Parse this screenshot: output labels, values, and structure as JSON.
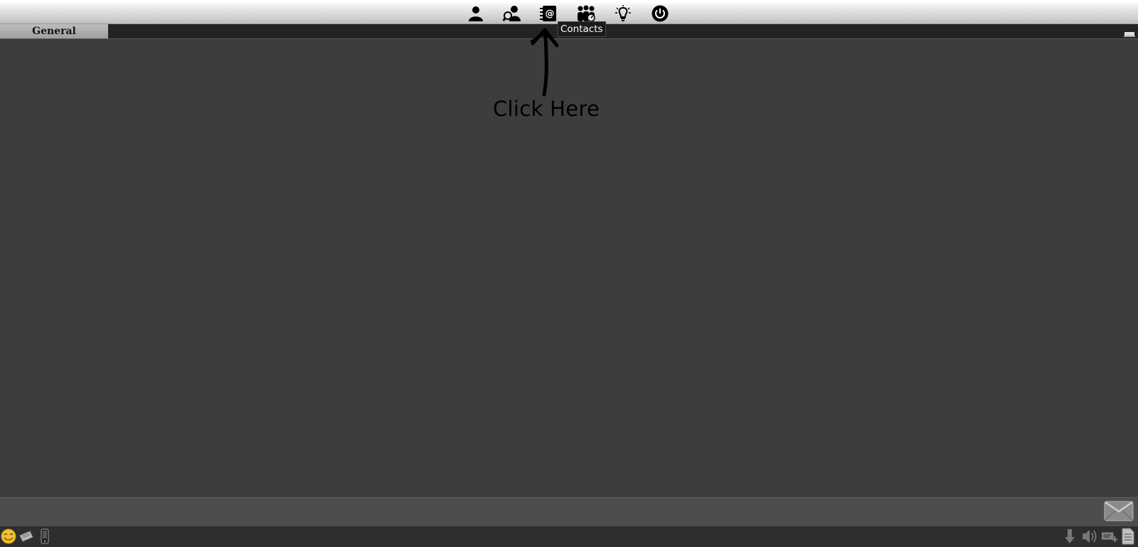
{
  "toolbar": {
    "buttons": [
      {
        "icon": "user-icon"
      },
      {
        "icon": "search-user-icon"
      },
      {
        "icon": "contacts-icon"
      },
      {
        "icon": "group-chat-icon"
      },
      {
        "icon": "lightbulb-icon"
      },
      {
        "icon": "power-icon"
      }
    ]
  },
  "tooltip": {
    "text": "Contacts"
  },
  "tabs": [
    {
      "label": "General",
      "active": true
    }
  ],
  "annotation": {
    "text": "Click Here"
  },
  "status_bar": {
    "left_icons": [
      "smiley-icon",
      "ticket-icon",
      "phone-icon"
    ],
    "right_icons": [
      "download-icon",
      "volume-icon",
      "add-message-icon",
      "document-icon"
    ]
  },
  "colors": {
    "background": "#3d3d3d",
    "toolbar": "#d4d4d4",
    "tab_active": "#ababab"
  }
}
